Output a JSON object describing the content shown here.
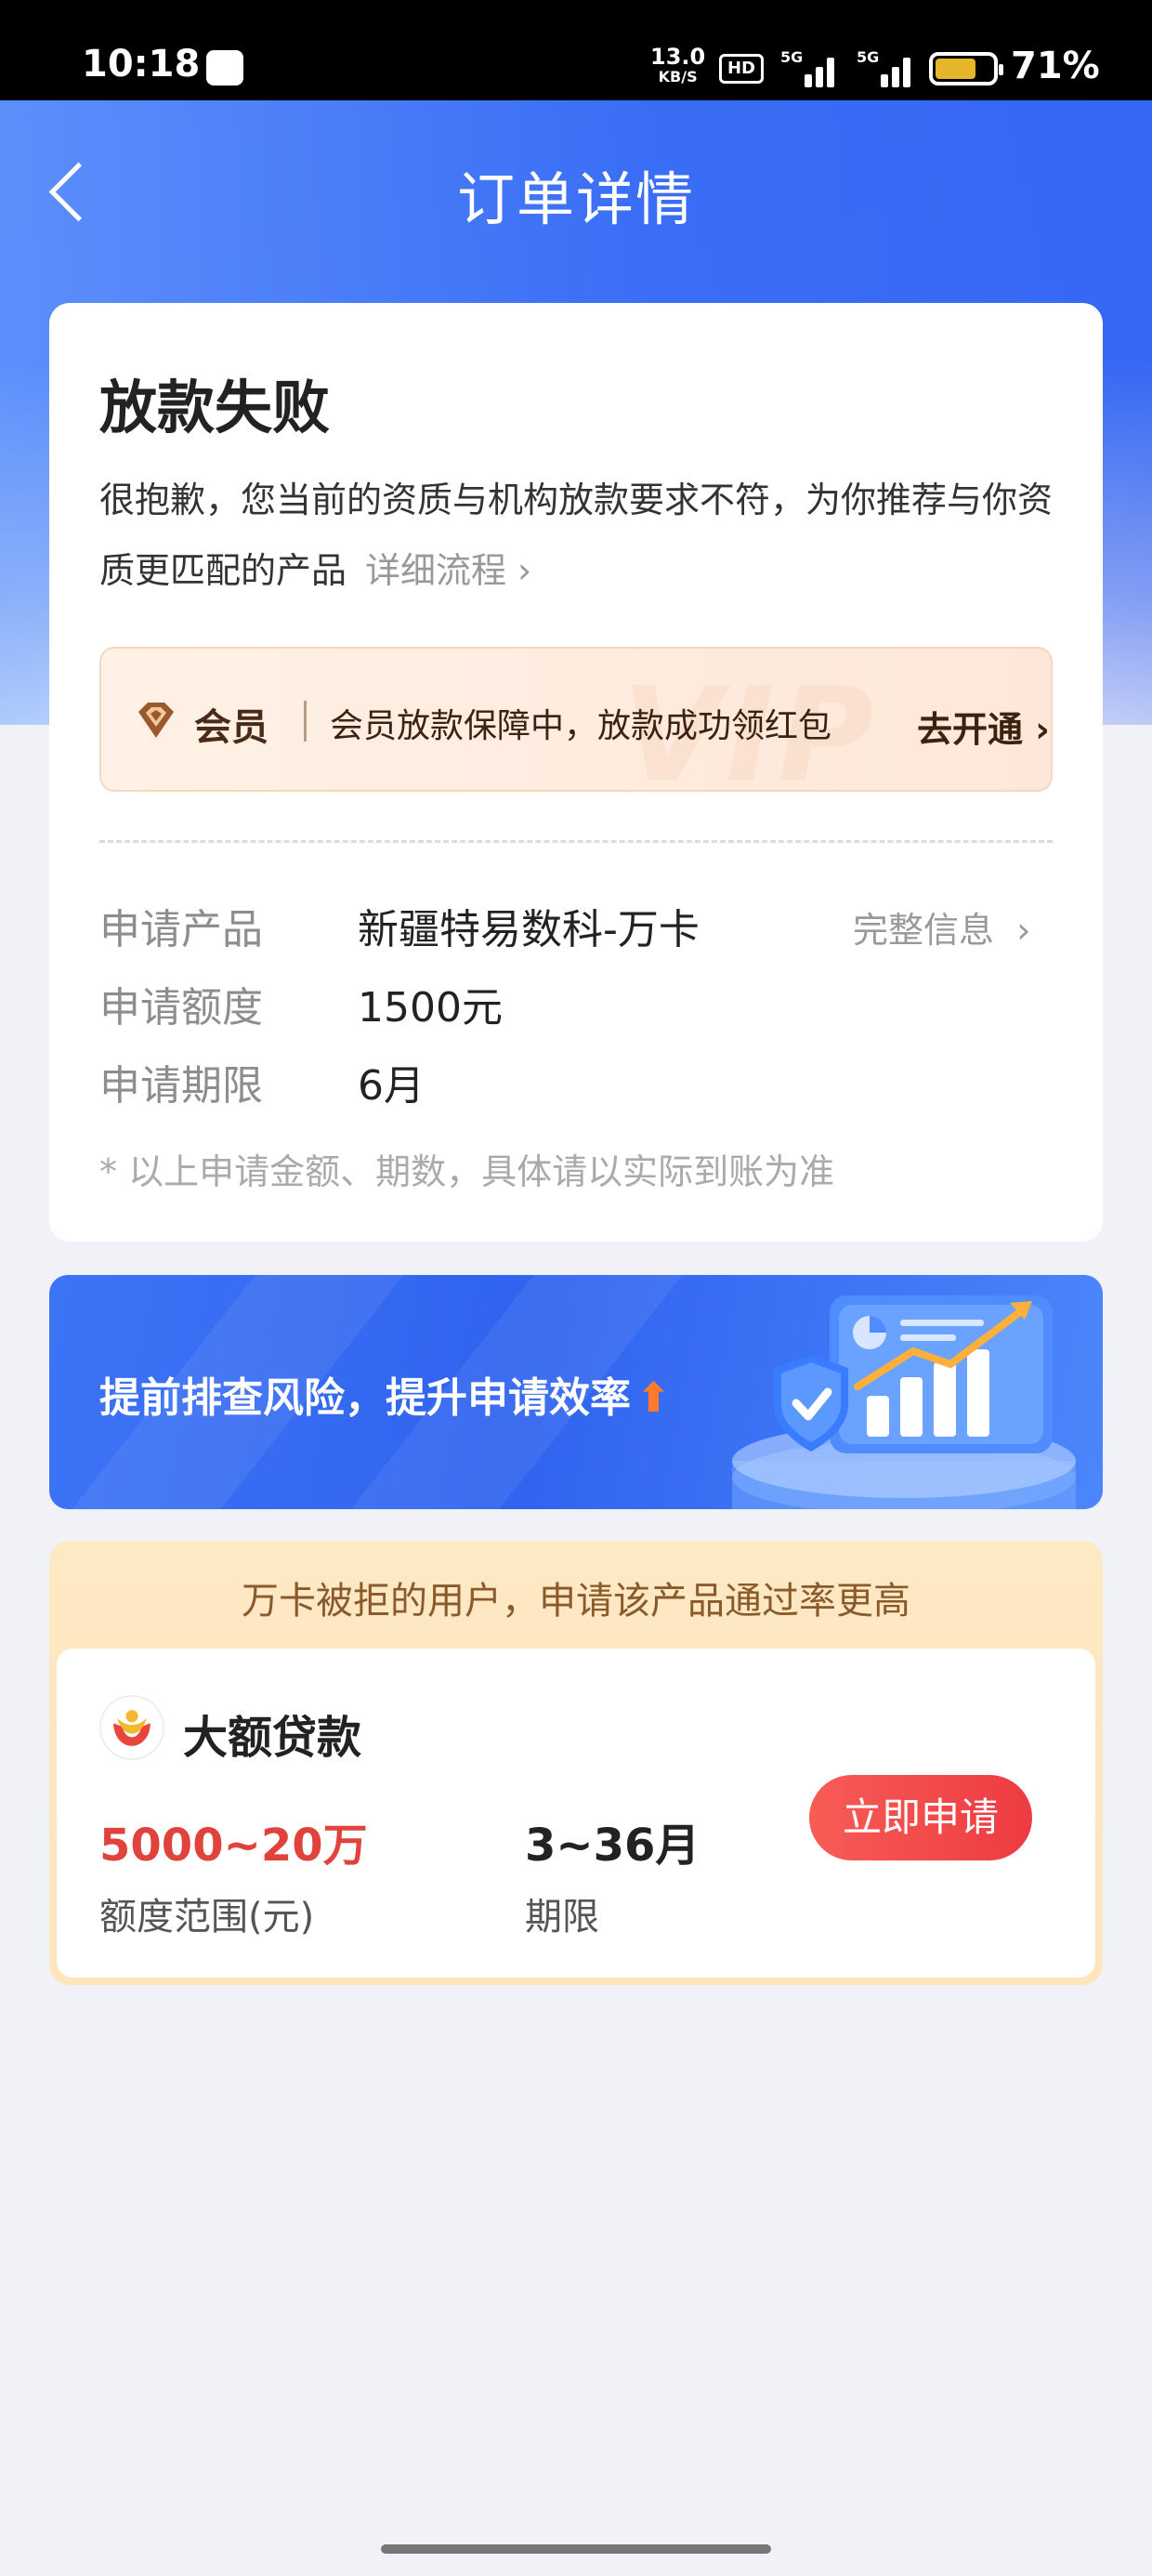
{
  "status_bar": {
    "time": "10:18",
    "net_speed": "13.0",
    "net_unit": "KB/S",
    "hd": "HD",
    "signal1_label": "5G",
    "signal2_label": "5G",
    "battery_percent": 71,
    "battery_text": "71%"
  },
  "nav": {
    "title": "订单详情"
  },
  "status_card": {
    "title": "放款失败",
    "description": "很抱歉，您当前的资质与机构放款要求不符，为你推荐与你资质更匹配的产品",
    "detail_link": "详细流程",
    "vip": {
      "label": "会员",
      "text": "会员放款保障中，放款成功领红包",
      "action": "去开通",
      "watermark": "VIP"
    },
    "rows": [
      {
        "key": "申请产品",
        "value": "新疆特易数科-万卡"
      },
      {
        "key": "申请额度",
        "value": "1500元"
      },
      {
        "key": "申请期限",
        "value": "6月"
      }
    ],
    "full_info": "完整信息",
    "disclaimer": "* 以上申请金额、期数，具体请以实际到账为准"
  },
  "risk_banner": {
    "text": "提前排查风险，提升申请效率"
  },
  "recommend": {
    "header": "万卡被拒的用户，申请该产品通过率更高",
    "product_name": "大额贷款",
    "amount_value": "5000~20万",
    "amount_label": "额度范围(元)",
    "term_value": "3~36月",
    "term_label": "期限",
    "apply_label": "立即申请"
  },
  "colors": {
    "accent_blue": "#3a6df5",
    "danger_red": "#e0423c",
    "apply_button": "#ee3b42",
    "vip_bg": "#fde7d8"
  }
}
